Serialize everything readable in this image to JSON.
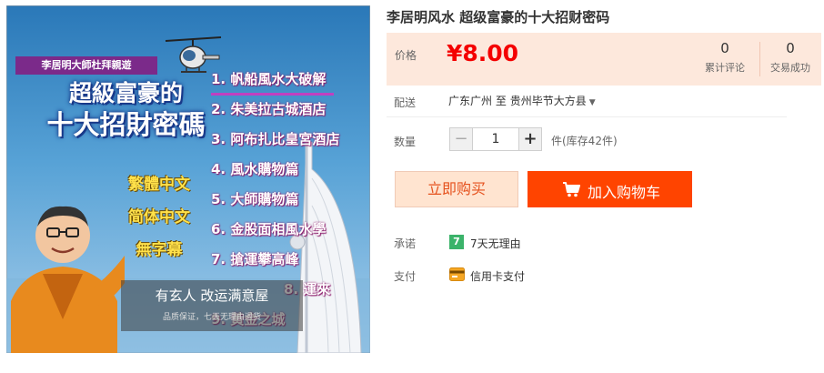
{
  "product": {
    "title": "李居明风水 超级富豪的十大招财密码",
    "image": {
      "banner": "李居明大師杜拜親遊",
      "title_line1": "超級富豪的",
      "title_line2": "十大招財密碼",
      "languages": [
        "繁體中文",
        "简体中文",
        "無字幕"
      ],
      "chapters": [
        "1. 帆船風水大破解",
        "2. 朱美拉古城酒店",
        "3. 阿布扎比皇宮酒店",
        "4. 風水購物篇",
        "5. 大師購物篇",
        "6. 金股面相風水學",
        "7. 搶運攀高峰",
        "8. 運來",
        "9. 黃金之城"
      ],
      "overlay_main": "有玄人 改运满意屋",
      "overlay_sub": "品质保证，七天无理由退货"
    }
  },
  "price": {
    "label": "价格",
    "value": "¥8.00",
    "accent_color": "#f40000",
    "box_color": "#fde8dc"
  },
  "stats": [
    {
      "number": "0",
      "label": "累计评论"
    },
    {
      "number": "0",
      "label": "交易成功"
    }
  ],
  "delivery": {
    "label": "配送",
    "from": "广东广州",
    "to_word": "至",
    "destination": "贵州毕节大方县"
  },
  "quantity": {
    "label": "数量",
    "value": "1",
    "minus": "−",
    "plus": "+",
    "stock": "件(库存42件)"
  },
  "actions": {
    "buy_now": "立即购买",
    "add_to_cart": "加入购物车",
    "cart_color": "#ff4400"
  },
  "promise": {
    "label": "承诺",
    "badge": "7",
    "text": "7天无理由"
  },
  "payment": {
    "label": "支付",
    "icon": "credit-card-icon",
    "text": "信用卡支付"
  }
}
